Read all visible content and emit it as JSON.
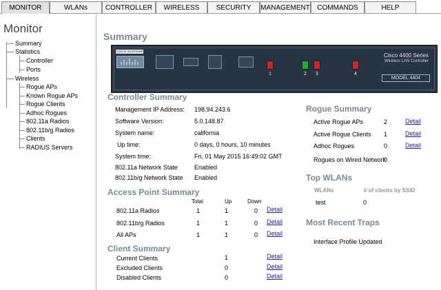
{
  "nav": {
    "tabs": [
      {
        "label": "MONITOR",
        "active": true
      },
      {
        "label": "WLANs"
      },
      {
        "label": "CONTROLLER"
      },
      {
        "label": "WIRELESS"
      },
      {
        "label": "SECURITY"
      },
      {
        "label": "MANAGEMENT"
      },
      {
        "label": "COMMANDS"
      },
      {
        "label": "HELP"
      }
    ]
  },
  "sidebar": {
    "title": "Monitor",
    "items": [
      "Summary",
      "Statistics",
      "Controller",
      "Ports",
      "Wireless",
      "Rogue APs",
      "Known Rogue APs",
      "Rogue Clients",
      "Adhoc Rogues",
      "802.11a Radios",
      "802.11b/g Radios",
      "Clients",
      "RADIUS Servers"
    ]
  },
  "page": {
    "title": "Summary"
  },
  "device": {
    "brand": "CISCO SYSTEMS",
    "model": "Cisco 4400 Series",
    "subtitle": "Wireless LAN Controller",
    "model_box": "MODEL 4404",
    "port_numbers": [
      "1",
      "2",
      "3",
      "4"
    ],
    "port_colors": [
      "#d42222",
      "#20b030",
      "#d42222",
      "#d42222"
    ]
  },
  "controller_summary": {
    "title": "Controller Summary",
    "rows": [
      {
        "label": "Management IP Address:",
        "value": "198.94.243.6"
      },
      {
        "label": "Software Version:",
        "value": "5.0.148.87"
      },
      {
        "label": "System name:",
        "value": "california"
      },
      {
        "label": "Up time:",
        "value": "0 days, 0 hours, 10 minutes"
      },
      {
        "label": "System time:",
        "value": "Fri, 01 May 2015 16:49:02 GMT"
      },
      {
        "label": "802.11a Network State",
        "value": "Enabled"
      },
      {
        "label": "802.11b/g Network State",
        "value": "Enabled"
      }
    ]
  },
  "ap_summary": {
    "title": "Access Point Summary",
    "headers": [
      "Total",
      "Up",
      "Down"
    ],
    "rows": [
      {
        "label": "802.11a Radios",
        "total": "1",
        "up": "1",
        "down": "0",
        "link": "Detail"
      },
      {
        "label": "802.11b/g Radios",
        "total": "1",
        "up": "1",
        "down": "0",
        "link": "Detail"
      },
      {
        "label": "All APs",
        "total": "1",
        "up": "1",
        "down": "0",
        "link": "Detail"
      }
    ]
  },
  "client_summary": {
    "title": "Client Summary",
    "rows": [
      {
        "label": "Current Clients",
        "value": "1",
        "link": "Detail"
      },
      {
        "label": "Excluded Clients",
        "value": "0",
        "link": "Detail"
      },
      {
        "label": "Disabled Clients",
        "value": "0",
        "link": "Detail"
      }
    ]
  },
  "rogue_summary": {
    "title": "Rogue Summary",
    "rows": [
      {
        "label": "Active Rogue APs",
        "value": "2",
        "link": "Detail"
      },
      {
        "label": "Active Rogue Clients",
        "value": "1",
        "link": "Detail"
      },
      {
        "label": "Adhoc Rogues",
        "value": "0",
        "link": "Detail"
      },
      {
        "label": "Rogues on Wired Network",
        "value": "0"
      }
    ]
  },
  "top_wlans": {
    "title": "Top WLANs",
    "headers": [
      "WLANs",
      "# of clients by SSID"
    ],
    "rows": [
      {
        "name": "test",
        "clients": "0"
      }
    ]
  },
  "traps": {
    "title": "Most Recent Traps",
    "items": [
      "Interface Profile Updated"
    ]
  }
}
